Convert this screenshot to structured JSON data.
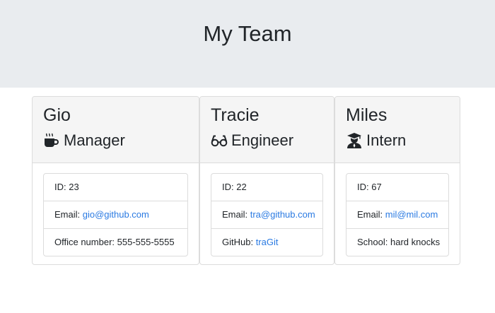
{
  "page": {
    "title": "My Team"
  },
  "colors": {
    "header_bg": "#e9ecef",
    "card_header_bg": "#f5f5f5",
    "link": "#2a7ae2",
    "border": "#dcdcdc"
  },
  "employees": [
    {
      "name": "Gio",
      "role": "Manager",
      "icon": "mug-icon",
      "id_text": "ID: 23",
      "email_label": "Email: ",
      "email": "gio@github.com",
      "third_label": "Office number: ",
      "third_value": "555-555-5555"
    },
    {
      "name": "Tracie",
      "role": "Engineer",
      "icon": "glasses-icon",
      "id_text": "ID: 22",
      "email_label": "Email: ",
      "email": "tra@github.com",
      "third_label": "GitHub: ",
      "third_value": "traGit"
    },
    {
      "name": "Miles",
      "role": "Intern",
      "icon": "graduate-icon",
      "id_text": "ID: 67",
      "email_label": "Email: ",
      "email": "mil@mil.com",
      "third_label": "School: ",
      "third_value": "hard knocks"
    }
  ]
}
